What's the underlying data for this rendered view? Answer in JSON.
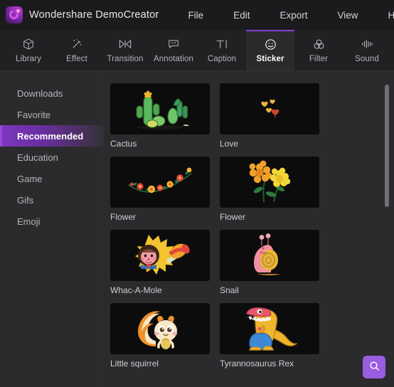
{
  "app": {
    "brand_name": "Wondershare DemoCreator",
    "logo_icon": "wondershare-logo-icon",
    "accent_color": "#8a3fd1",
    "search_button_color": "#9a5ce0",
    "panel_background": "#2b2b2d",
    "thumbnail_background": "#0c0c0c"
  },
  "menu": {
    "items": [
      {
        "label": "File"
      },
      {
        "label": "Edit"
      },
      {
        "label": "Export"
      },
      {
        "label": "View"
      },
      {
        "label": "Help"
      }
    ]
  },
  "tabs": {
    "active": "Sticker",
    "items": [
      {
        "label": "Library",
        "icon": "cube-icon"
      },
      {
        "label": "Effect",
        "icon": "magic-wand-icon"
      },
      {
        "label": "Transition",
        "icon": "transition-bowtie-icon"
      },
      {
        "label": "Annotation",
        "icon": "speech-bubble-icon"
      },
      {
        "label": "Caption",
        "icon": "text-tool-icon"
      },
      {
        "label": "Sticker",
        "icon": "smiley-face-icon"
      },
      {
        "label": "Filter",
        "icon": "three-circles-icon"
      },
      {
        "label": "Sound",
        "icon": "audio-waveform-icon"
      }
    ]
  },
  "sidebar": {
    "active": "Recommended",
    "items": [
      {
        "label": "Downloads"
      },
      {
        "label": "Favorite"
      },
      {
        "label": "Recommended"
      },
      {
        "label": "Education"
      },
      {
        "label": "Game"
      },
      {
        "label": "Gifs"
      },
      {
        "label": "Emoji"
      }
    ]
  },
  "stickers": {
    "items": [
      {
        "label": "Cactus",
        "art": "cactus"
      },
      {
        "label": "Love",
        "art": "love"
      },
      {
        "label": "Flower",
        "art": "flower-vine"
      },
      {
        "label": "Flower",
        "art": "flower-pair"
      },
      {
        "label": "Whac-A-Mole",
        "art": "whacamole"
      },
      {
        "label": "Snail",
        "art": "snail"
      },
      {
        "label": "Little squirrel",
        "art": "squirrel"
      },
      {
        "label": "Tyrannosaurus Rex",
        "art": "trex"
      }
    ]
  },
  "search": {
    "icon": "search-icon",
    "label": "Search"
  },
  "scrollbar": {
    "thumb_color": "#707075"
  }
}
